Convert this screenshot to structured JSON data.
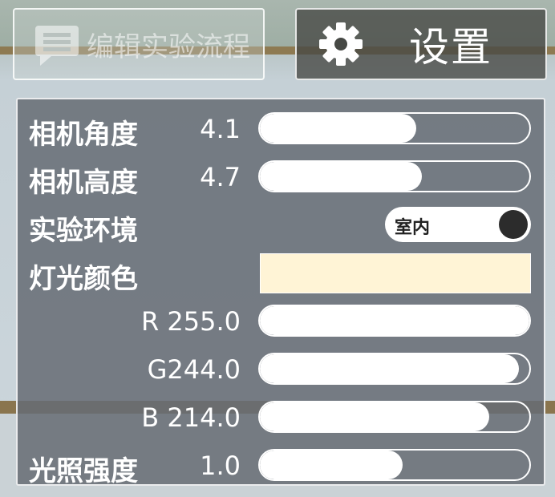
{
  "toolbar": {
    "edit_label": "编辑实验流程",
    "settings_label": "设置"
  },
  "panel": {
    "camera_angle": {
      "label": "相机角度",
      "value": "4.1",
      "level": 0.58
    },
    "camera_height": {
      "label": "相机高度",
      "value": "4.7",
      "level": 0.6
    },
    "environment": {
      "label": "实验环境",
      "toggle_text": "室内"
    },
    "light_color": {
      "label": "灯光颜色",
      "color": "#FFF4D6"
    },
    "r": {
      "channel": "R",
      "value": "255.0",
      "level": 1.0
    },
    "g": {
      "channel": "G",
      "value": "244.0",
      "level": 0.96
    },
    "b": {
      "channel": "B",
      "value": "214.0",
      "level": 0.85
    },
    "intensity": {
      "label": "光照强度",
      "value": "1.0",
      "level": 0.53
    }
  },
  "colors": {
    "panel_bg": "#666C74",
    "settings_bg": "#464844"
  }
}
